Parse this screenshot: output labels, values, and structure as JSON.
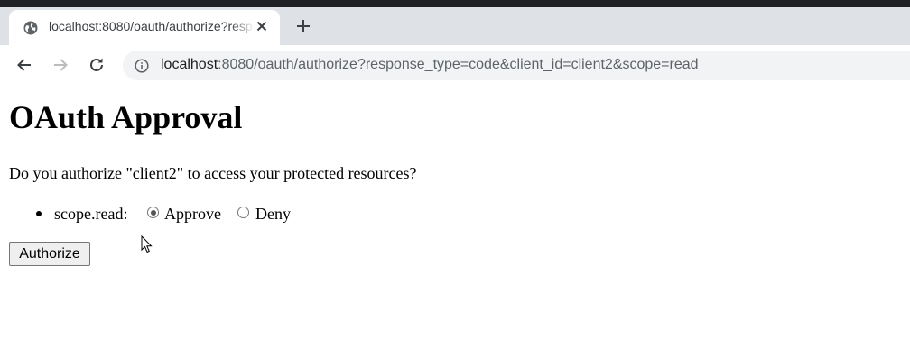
{
  "browser": {
    "tab": {
      "title": "localhost:8080/oauth/authorize?response_type=code&client_id=client2&scope=read",
      "favicon": "globe-icon",
      "close_icon": "close-icon"
    },
    "new_tab_icon": "plus-icon",
    "nav": {
      "back_icon": "arrow-left-icon",
      "forward_icon": "arrow-right-icon",
      "reload_icon": "reload-icon"
    },
    "address_bar": {
      "info_icon": "info-icon",
      "url_host": "localhost",
      "url_rest": ":8080/oauth/authorize?response_type=code&client_id=client2&scope=read"
    }
  },
  "page": {
    "heading": "OAuth Approval",
    "question": "Do you authorize \"client2\" to access your protected resources?",
    "scopes": [
      {
        "label": "scope.read:",
        "options": [
          {
            "label": "Approve",
            "checked": true
          },
          {
            "label": "Deny",
            "checked": false
          }
        ]
      }
    ],
    "authorize_button": "Authorize"
  },
  "colors": {
    "tab_bar": "#dee1e6",
    "omnibox": "#f1f3f4",
    "top_strip": "#202124"
  }
}
